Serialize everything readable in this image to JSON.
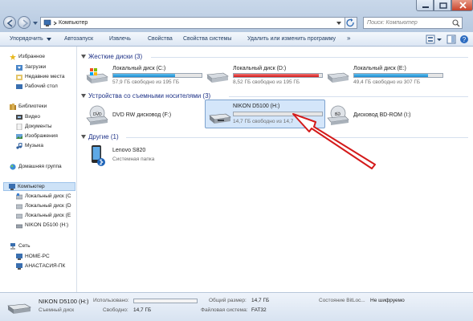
{
  "address": {
    "path": "Компьютер",
    "search_placeholder": "Поиск: Компьютер"
  },
  "toolbar": [
    "Упорядочить",
    "Автозапуск",
    "Извлечь",
    "Свойства",
    "Свойства системы",
    "Удалить или изменить программу"
  ],
  "sidebar": {
    "favorites": "Избранное",
    "favorites_items": [
      "Загрузки",
      "Недавние места",
      "Рабочий стол"
    ],
    "libraries": "Библиотеки",
    "libraries_items": [
      "Видео",
      "Документы",
      "Изображения",
      "Музыка"
    ],
    "homegroup": "Домашняя группа",
    "computer": "Компьютер",
    "computer_items": [
      "Локальный диск (C",
      "Локальный диск (D",
      "Локальный диск (E",
      "NIKON D5100 (H:)"
    ],
    "network": "Сеть",
    "network_items": [
      "HOME-PC",
      "АНАСТАСИЯ-ПК"
    ]
  },
  "groups": {
    "hdd": "Жесткие диски (3)",
    "removable": "Устройства со съемными носителями (3)",
    "other": "Другие (1)"
  },
  "drives": [
    {
      "name": "Локальный диск (C:)",
      "free": "57,9 ГБ свободно из 195 ГБ",
      "used_fraction": 0.7,
      "color": "#1c8bd0"
    },
    {
      "name": "Локальный диск (D:)",
      "free": "8,52 ГБ свободно из 195 ГБ",
      "used_fraction": 0.96,
      "color": "#d21c1c"
    },
    {
      "name": "Локальный диск (E:)",
      "free": "49,4 ГБ свободно из 307 ГБ",
      "used_fraction": 0.84,
      "color": "#1c8bd0"
    }
  ],
  "removable": [
    {
      "name": "DVD RW дисковод (F:)"
    },
    {
      "name": "NIKON D5100 (H:)",
      "free": "14,7 ГБ свободно из 14,7",
      "used_fraction": 0.0
    },
    {
      "name": "Дисковод BD-ROM (I:)"
    }
  ],
  "other": [
    {
      "name": "Lenovo S820",
      "sub": "Системная папка"
    }
  ],
  "status": {
    "name": "NIKON D5100 (H:)",
    "type": "Съемный диск",
    "used_label": "Использовано:",
    "free_label": "Свободно:",
    "free_value": "14,7 ГБ",
    "total_label": "Общий размер:",
    "total_value": "14,7 ГБ",
    "fs_label": "Файловая система:",
    "fs_value": "FAT32",
    "bitlocker_label": "Состояние BitLoc...",
    "bitlocker_value": "Не шифруемо"
  }
}
